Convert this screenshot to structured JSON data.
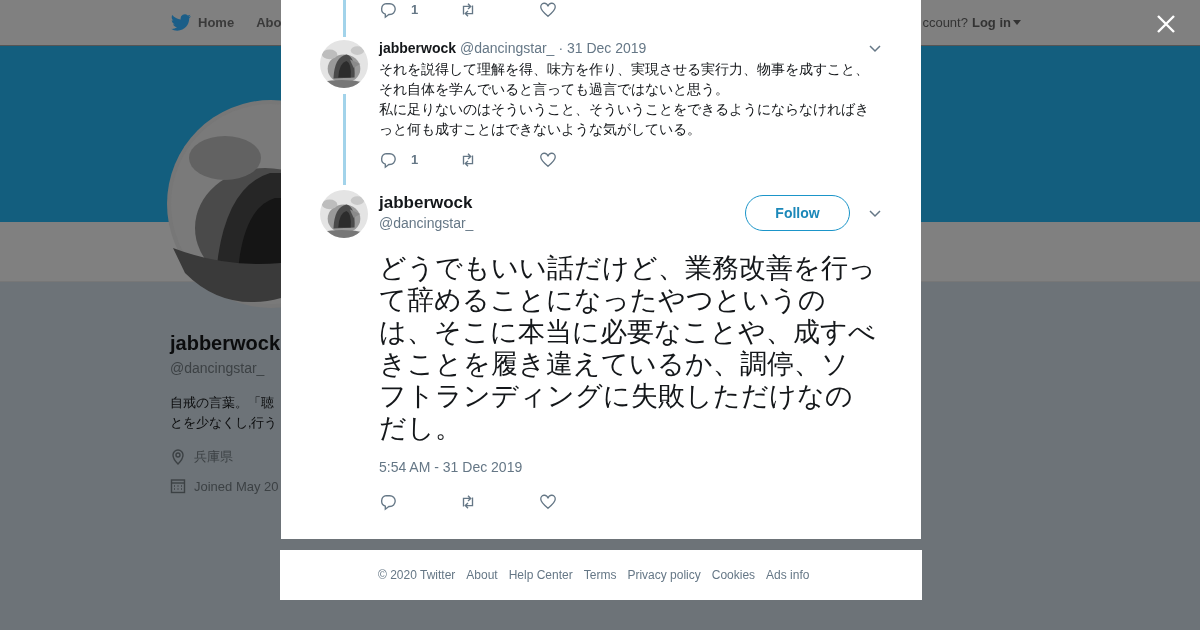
{
  "background": {
    "nav": {
      "items": [
        "Home",
        "Abo"
      ],
      "account_prompt": "ccount?",
      "login": "Log in"
    },
    "profile": {
      "name": "jabberwock",
      "handle": "@dancingstar_",
      "bio": [
        "自戒の言葉。「聴",
        "とを少なくし,行う"
      ],
      "location": "兵庫県",
      "joined": "Joined May 20"
    }
  },
  "thread": {
    "top_actions": {
      "replies": "1"
    },
    "reply": {
      "name": "jabberwock",
      "handle": "@dancingstar_",
      "date": "· 31 Dec 2019",
      "text": [
        "それを説得して理解を得、味方を作り、実現させる実行力、物事を成すこと、",
        "それ自体を学んでいると言っても過言ではないと思う。",
        "私に足りないのはそういうこと、そういうことをできるようにならなければき",
        "っと何も成すことはできないような気がしている。"
      ],
      "replies": "1"
    },
    "main": {
      "name": "jabberwock",
      "handle": "@dancingstar_",
      "follow": "Follow",
      "text": [
        "どうでもいい話だけど、業務改善を行っ",
        "て辞めることになったやつというの",
        "は、そこに本当に必要なことや、成すべ",
        "きことを履き違えているか、調停、ソ",
        "フトランディングに失敗しただけなの",
        "だし。"
      ],
      "timestamp": "5:54 AM - 31 Dec 2019"
    }
  },
  "footer": [
    "© 2020 Twitter",
    "About",
    "Help Center",
    "Terms",
    "Privacy policy",
    "Cookies",
    "Ads info"
  ]
}
